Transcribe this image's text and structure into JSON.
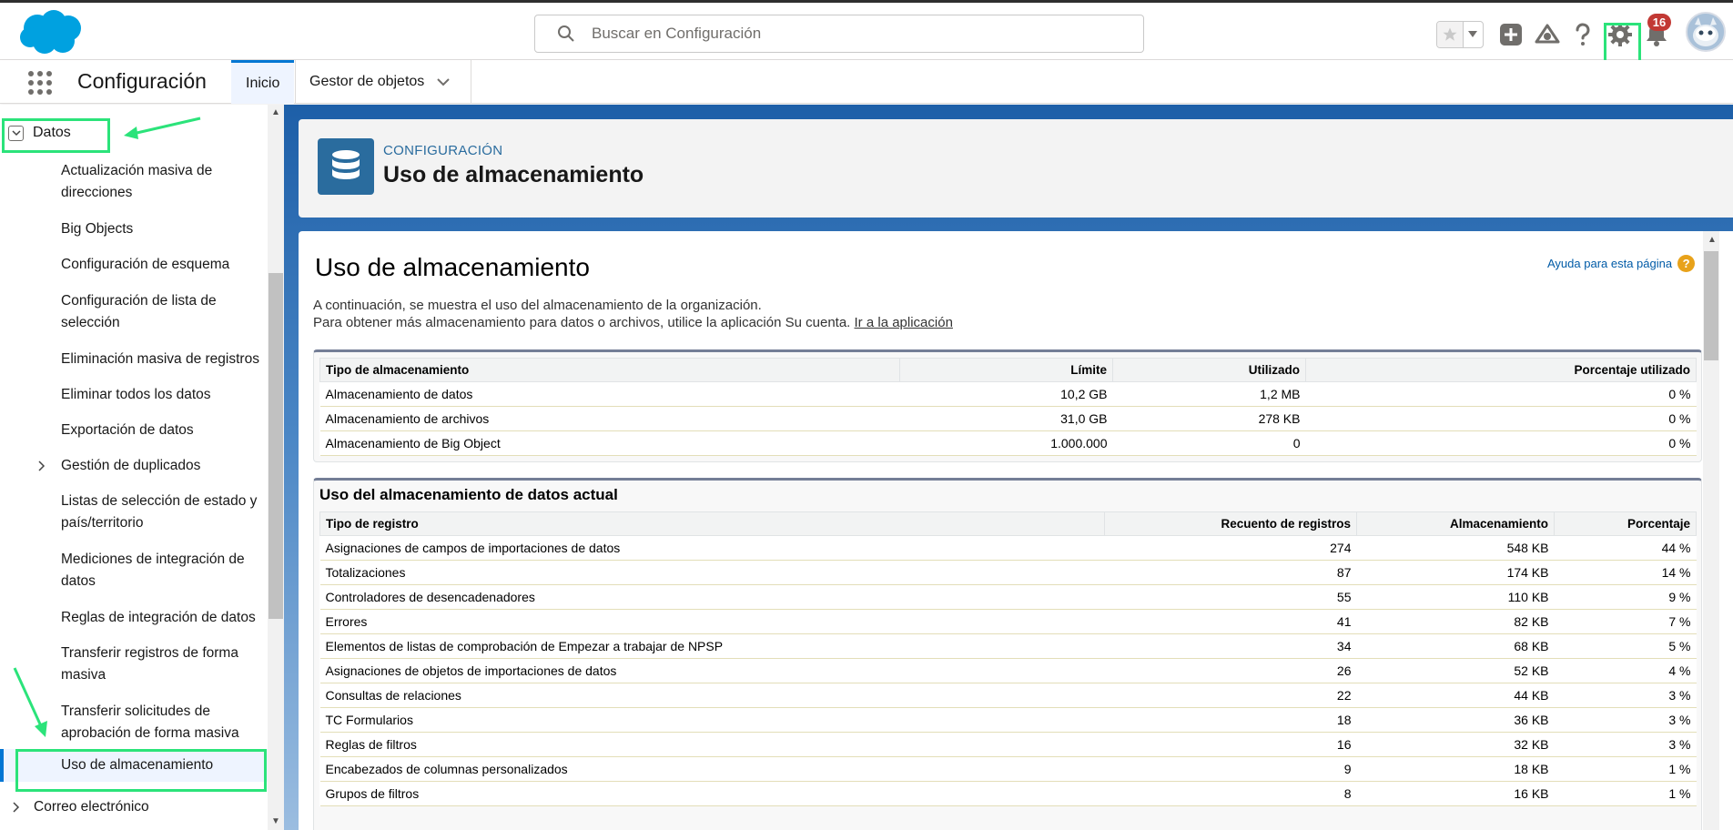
{
  "header": {
    "search_placeholder": "Buscar en Configuración",
    "notifications_count": "16"
  },
  "nav": {
    "app_title": "Configuración",
    "tabs": [
      {
        "label": "Inicio",
        "active": true
      },
      {
        "label": "Gestor de objetos",
        "active": false
      }
    ]
  },
  "sidebar": {
    "section": "Datos",
    "items": [
      "Actualización masiva de direcciones",
      "Big Objects",
      "Configuración de esquema",
      "Configuración de lista de selección",
      "Eliminación masiva de registros",
      "Eliminar todos los datos",
      "Exportación de datos",
      "Gestión de duplicados",
      "Listas de selección de estado y país/territorio",
      "Mediciones de integración de datos",
      "Reglas de integración de datos",
      "Transferir registros de forma masiva",
      "Transferir solicitudes de aprobación de forma masiva",
      "Uso de almacenamiento"
    ],
    "next_section": "Correo electrónico"
  },
  "page_header": {
    "eyebrow": "CONFIGURACIÓN",
    "title": "Uso de almacenamiento"
  },
  "content": {
    "title": "Uso de almacenamiento",
    "help_label": "Ayuda para esta página",
    "intro_line1": "A continuación, se muestra el uso del almacenamiento de la organización.",
    "intro_line2": "Para obtener más almacenamiento para datos o archivos, utilice la aplicación Su cuenta.",
    "intro_link": "Ir a la aplicación",
    "storage_table": {
      "headers": [
        "Tipo de almacenamiento",
        "Límite",
        "Utilizado",
        "Porcentaje utilizado"
      ],
      "rows": [
        [
          "Almacenamiento de datos",
          "10,2 GB",
          "1,2 MB",
          "0 %"
        ],
        [
          "Almacenamiento de archivos",
          "31,0 GB",
          "278 KB",
          "0 %"
        ],
        [
          "Almacenamiento de Big Object",
          "1.000.000",
          "0",
          "0 %"
        ]
      ]
    },
    "current_usage": {
      "title": "Uso del almacenamiento de datos actual",
      "headers": [
        "Tipo de registro",
        "Recuento de registros",
        "Almacenamiento",
        "Porcentaje"
      ],
      "rows": [
        [
          "Asignaciones de campos de importaciones de datos",
          "274",
          "548 KB",
          "44 %"
        ],
        [
          "Totalizaciones",
          "87",
          "174 KB",
          "14 %"
        ],
        [
          "Controladores de desencadenadores",
          "55",
          "110 KB",
          "9 %"
        ],
        [
          "Errores",
          "41",
          "82 KB",
          "7 %"
        ],
        [
          "Elementos de listas de comprobación de Empezar a trabajar de NPSP",
          "34",
          "68 KB",
          "5 %"
        ],
        [
          "Asignaciones de objetos de importaciones de datos",
          "26",
          "52 KB",
          "4 %"
        ],
        [
          "Consultas de relaciones",
          "22",
          "44 KB",
          "3 %"
        ],
        [
          "TC Formularios",
          "18",
          "36 KB",
          "3 %"
        ],
        [
          "Reglas de filtros",
          "16",
          "32 KB",
          "3 %"
        ],
        [
          "Encabezados de columnas personalizados",
          "9",
          "18 KB",
          "1 %"
        ],
        [
          "Grupos de filtros",
          "8",
          "16 KB",
          "1 %"
        ]
      ]
    }
  }
}
